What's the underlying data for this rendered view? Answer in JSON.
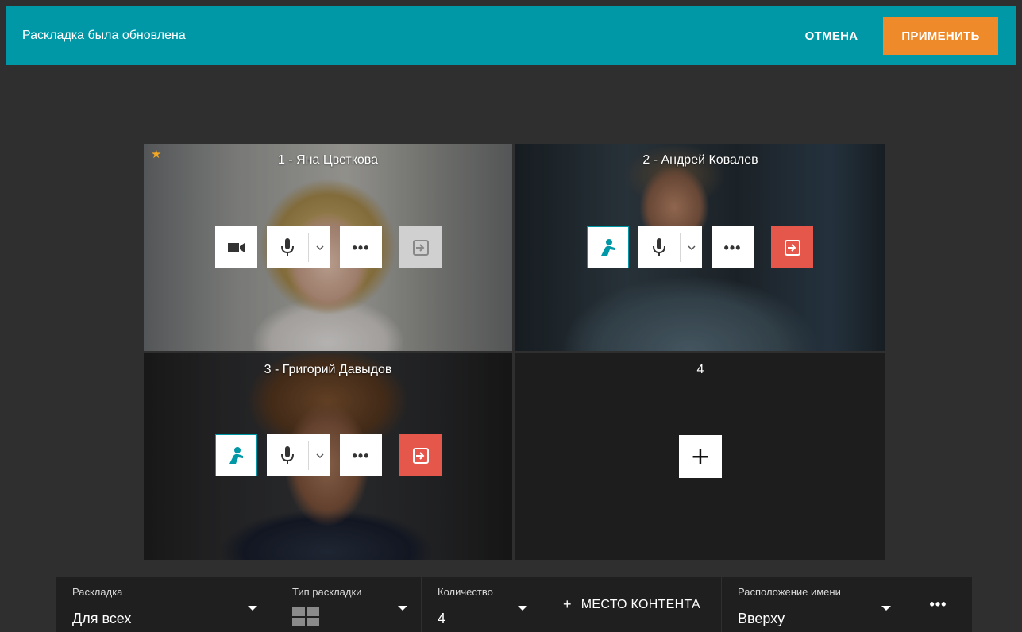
{
  "topbar": {
    "message": "Раскладка была обновлена",
    "cancel_label": "ОТМЕНА",
    "apply_label": "ПРИМЕНИТЬ"
  },
  "tiles": [
    {
      "title": "1 - Яна Цветкова",
      "has_star": true,
      "controls": [
        "camera-icon",
        "microphone-icon",
        "chevron-down-icon",
        "more-icon",
        "exit-icon-disabled"
      ]
    },
    {
      "title": "2 - Андрей Ковалев",
      "controls": [
        "presenter-icon",
        "microphone-icon",
        "chevron-down-icon",
        "more-icon",
        "exit-icon"
      ]
    },
    {
      "title": "3 - Григорий Давыдов",
      "controls": [
        "presenter-icon",
        "microphone-icon",
        "chevron-down-icon",
        "more-icon",
        "exit-icon"
      ]
    },
    {
      "title": "4",
      "add_icon": "plus-icon"
    }
  ],
  "toolbar": {
    "layout": {
      "label": "Раскладка",
      "value": "Для всех"
    },
    "layout_type": {
      "label": "Тип раскладки",
      "icon": "grid-2x2-icon"
    },
    "count": {
      "label": "Количество",
      "value": "4"
    },
    "content_place": {
      "label": "МЕСТО КОНТЕНТА",
      "icon": "plus-icon"
    },
    "name_position": {
      "label": "Расположение имени",
      "value": "Вверху"
    },
    "more_icon": "more-icon"
  },
  "colors": {
    "accent": "#0097a7",
    "apply": "#ef8a2a",
    "danger": "#e5574b",
    "star": "#f5a623"
  }
}
